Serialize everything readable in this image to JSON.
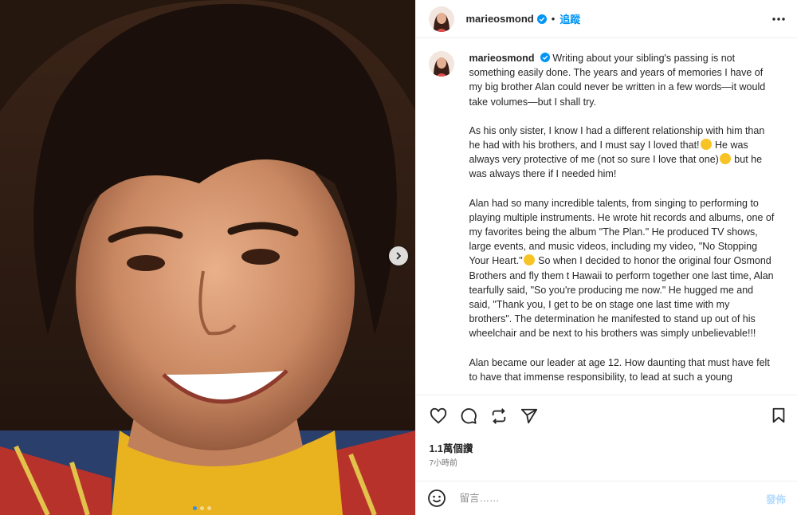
{
  "post": {
    "username": "marieosmond",
    "follow_label": "追蹤",
    "separator": "•",
    "icons": {
      "verified": "verified-badge-icon",
      "more": "more-options-icon",
      "next": "chevron-right-icon",
      "like": "heart-icon",
      "comment": "comment-icon",
      "share": "repost-icon",
      "send": "send-icon",
      "save": "bookmark-icon",
      "emoji": "emoji-icon"
    },
    "colors": {
      "verified": "#0095f6",
      "follow": "#0095f6",
      "post_disabled": "#b3dbff"
    }
  },
  "caption": {
    "p1": "Writing about your sibling's passing is not something easily done. The years and years of memories I have of my big brother Alan could never be written in a few words—it would take volumes—but I shall try.",
    "p2a": "As his only sister, I know I had a different relationship with him than he had with his brothers, and I must say I loved that!",
    "p2b": " He was always very protective of me (not so sure I love that one)",
    "p2c": " but he was always there if I needed him!",
    "p3a": "Alan had so many incredible talents, from singing to performing to playing multiple instruments. He wrote hit records and albums, one of my favorites being the album \"The Plan.\" He produced TV shows, large events, and music videos, including my video, \"No Stopping Your Heart.\"",
    "p3b": " So when I decided to honor the original four Osmond Brothers and fly them t Hawaii to perform together one last time, Alan tearfully said, \"So you're producing me now.\" He hugged me and said, \"Thank you, I get to be on stage one last time with my brothers\". The determination he manifested to stand up out of his wheelchair and be next to his brothers was simply unbelievable!!!",
    "p4": "Alan became our leader at age 12. How daunting that must have felt to have that immense responsibility, to lead at such a young"
  },
  "stats": {
    "likes": "1.1萬個讚",
    "time": "7小時前"
  },
  "comment": {
    "placeholder": "留言……",
    "post_label": "發佈"
  },
  "carousel": {
    "slides": 3,
    "current": 1
  }
}
